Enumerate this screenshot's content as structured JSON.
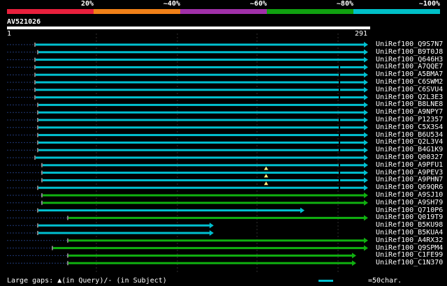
{
  "legend": {
    "labels": [
      "20%",
      "~40%",
      "~60%",
      "~80%",
      "~100%"
    ],
    "colors": [
      "#e8203c",
      "#f08018",
      "#a030a8",
      "#10a010",
      "#00c0c8"
    ]
  },
  "query": {
    "name": "AV521026",
    "start": "1",
    "end": "291"
  },
  "hits": [
    {
      "name": "UniRef100_Q9S7N7",
      "color": "cyan"
    },
    {
      "name": "UniRef100_B9T0J8",
      "color": "cyan"
    },
    {
      "name": "UniRef100_Q646H3",
      "color": "cyan"
    },
    {
      "name": "UniRef100_A7QQE7",
      "color": "cyan"
    },
    {
      "name": "UniRef100_A5BMA7",
      "color": "cyan"
    },
    {
      "name": "UniRef100_C6SWM2",
      "color": "cyan"
    },
    {
      "name": "UniRef100_C6SVU4",
      "color": "cyan"
    },
    {
      "name": "UniRef100_Q2L3E3",
      "color": "cyan"
    },
    {
      "name": "UniRef100_B8LNE8",
      "color": "cyan"
    },
    {
      "name": "UniRef100_A9NPY7",
      "color": "cyan"
    },
    {
      "name": "UniRef100_P12357",
      "color": "cyan"
    },
    {
      "name": "UniRef100_C5X3S4",
      "color": "cyan"
    },
    {
      "name": "UniRef100_B6U534",
      "color": "cyan"
    },
    {
      "name": "UniRef100_Q2L3V4",
      "color": "cyan"
    },
    {
      "name": "UniRef100_B4G1K9",
      "color": "cyan"
    },
    {
      "name": "UniRef100_Q00327",
      "color": "cyan"
    },
    {
      "name": "UniRef100_A9PFU1",
      "color": "cyan"
    },
    {
      "name": "UniRef100_A9PEV3",
      "color": "cyan"
    },
    {
      "name": "UniRef100_A9PHN7",
      "color": "cyan"
    },
    {
      "name": "UniRef100_Q69QR6",
      "color": "cyan"
    },
    {
      "name": "UniRef100_A9SJ10",
      "color": "green"
    },
    {
      "name": "UniRef100_A9SH79",
      "color": "green"
    },
    {
      "name": "UniRef100_Q710P6",
      "color": "cyan"
    },
    {
      "name": "UniRef100_Q019T9",
      "color": "green"
    },
    {
      "name": "UniRef100_B5KU98",
      "color": "cyan"
    },
    {
      "name": "UniRef100_B5KUA4",
      "color": "cyan"
    },
    {
      "name": "UniRef100_A4RX32",
      "color": "green"
    },
    {
      "name": "UniRef100_Q9SPM4",
      "color": "green"
    },
    {
      "name": "UniRef100_C1FE99",
      "color": "green"
    },
    {
      "name": "UniRef100_C1N370",
      "color": "green"
    }
  ],
  "footer": {
    "gaps_text": "Large gaps: ▲(in Query)/- (in Subject)",
    "scale_text": "=50char."
  }
}
